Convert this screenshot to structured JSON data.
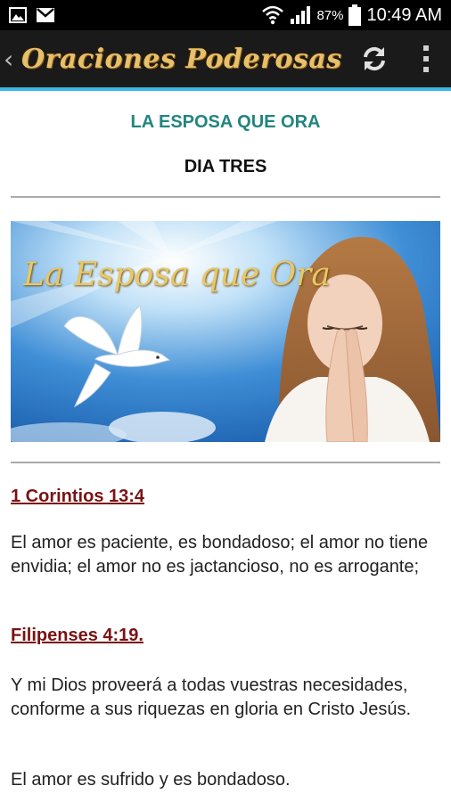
{
  "status_bar": {
    "battery": "87%",
    "time": "10:49 AM",
    "icons": [
      "image-icon",
      "gmail-icon",
      "wifi-icon",
      "signal-icon",
      "battery-icon"
    ]
  },
  "action_bar": {
    "title": "Oraciones Poderosas",
    "icons": [
      "back-chevron-icon",
      "refresh-icon",
      "overflow-menu-icon"
    ]
  },
  "content": {
    "heading": "LA ESPOSA QUE ORA",
    "subheading": "DIA TRES",
    "banner_text": "La Esposa que Ora",
    "verse1_ref": "1 Corintios 13:4",
    "verse1_text": "El amor es paciente, es bondadoso; el amor no tiene envidia; el amor no es jactancioso, no es arrogante;",
    "verse2_ref": "Filipenses 4:19.",
    "verse2_text": "Y mi Dios proveerá a todas vuestras necesidades, conforme a sus riquezas en gloria en Cristo Jesús.",
    "closing_text": "El amor es sufrido y es bondadoso."
  },
  "colors": {
    "heading": "#23857f",
    "reference": "#7a1212",
    "accent_line": "#3cb8e4",
    "title_gold": "#e6c06b"
  }
}
